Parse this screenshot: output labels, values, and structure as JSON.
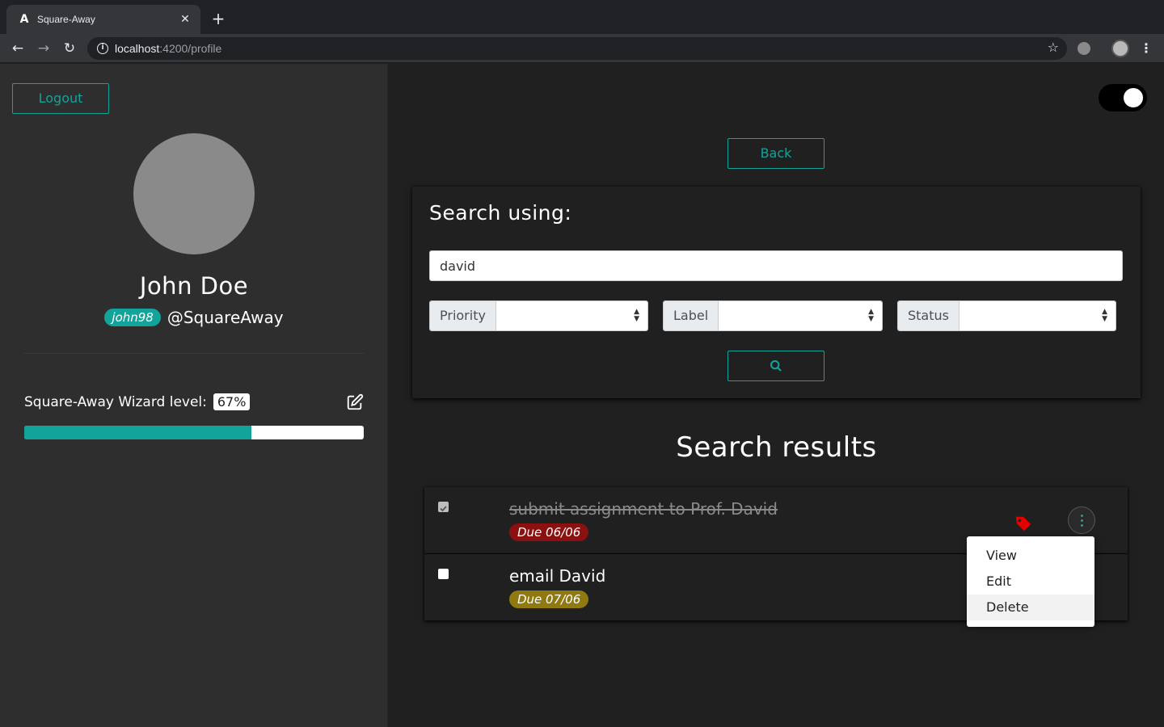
{
  "browser": {
    "tab_title": "Square-Away",
    "tab_favicon": "A",
    "url_host": "localhost",
    "url_path": ":4200/profile"
  },
  "sidebar": {
    "logout_label": "Logout",
    "user_name": "John Doe",
    "handle": "john98",
    "org": "@SquareAway",
    "level_label": "Square-Away Wizard level:",
    "level_value": "67%",
    "level_fraction": 0.67
  },
  "main": {
    "dark_mode_on": true,
    "back_label": "Back",
    "search": {
      "title": "Search using:",
      "query": "david",
      "priority_label": "Priority",
      "label_label": "Label",
      "status_label": "Status"
    },
    "results_title": "Search results",
    "tasks": [
      {
        "title": "submit assignment to Prof. David",
        "due": "Due 06/06",
        "done": true,
        "due_color": "#8b1010"
      },
      {
        "title": "email David",
        "due": "Due 07/06",
        "done": false,
        "due_color": "#8f7a12"
      }
    ],
    "menu": [
      "View",
      "Edit",
      "Delete"
    ]
  },
  "colors": {
    "accent": "#12a39a",
    "tag": "#e60000"
  }
}
